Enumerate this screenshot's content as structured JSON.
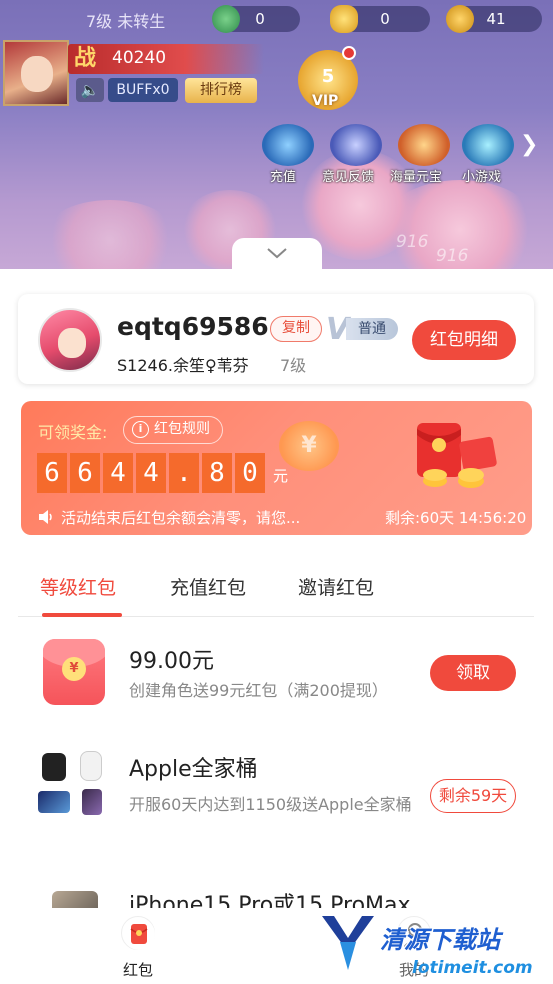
{
  "game": {
    "level_status": "7级 未转生",
    "resources": [
      "0",
      "0",
      "41"
    ],
    "power_badge": "战",
    "power_value": "40240",
    "buff_label": "BUFFx0",
    "rank_label": "排行榜",
    "vip_level": "5",
    "vip_label": "VIP",
    "icons": [
      "充值",
      "意见反馈",
      "海量元宝",
      "小游戏"
    ],
    "damage_texts": [
      "916",
      "916"
    ]
  },
  "user": {
    "name": "eqtq69586",
    "copy_label": "复制",
    "member_tier": "普通",
    "server_and_role": "S1246.余笙♀苇芬",
    "level": "7级",
    "detail_button": "红包明细"
  },
  "reward": {
    "title": "可领奖金:",
    "rules_label": "红包规则",
    "amount_digits": [
      "6",
      "6",
      "4",
      "4",
      ".",
      "8",
      "0"
    ],
    "unit": "元",
    "notice": "活动结束后红包余额会清零，请您...",
    "remaining": "剩余:60天 14:56:20"
  },
  "tabs": [
    "等级红包",
    "充值红包",
    "邀请红包"
  ],
  "items": [
    {
      "title": "99.00元",
      "desc": "创建角色送99元红包（满200提现）",
      "action": "领取"
    },
    {
      "title": "Apple全家桶",
      "desc": "开服60天内达到1150级送Apple全家桶",
      "action": "剩余59天"
    },
    {
      "title": "iPhone15 Pro或15 ProMax"
    }
  ],
  "nav": {
    "redpacket": "红包",
    "mine": "我的"
  },
  "watermark": {
    "text": "清源下载站",
    "url": "lotimeit.com"
  },
  "colors": {
    "accent": "#f04a3d",
    "reward_gradient": "#ff7a5a",
    "digit_bg": "#f56a2c"
  }
}
